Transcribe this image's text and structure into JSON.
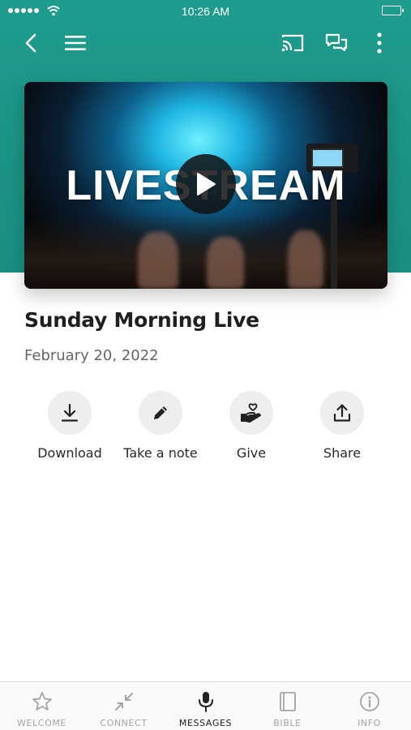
{
  "status_bar": {
    "time": "10:26 AM"
  },
  "video": {
    "overlay_text": "LIVESTREAM"
  },
  "message": {
    "title": "Sunday Morning Live",
    "date": "February 20, 2022"
  },
  "actions": [
    {
      "label": "Download",
      "icon": "download-icon"
    },
    {
      "label": "Take a note",
      "icon": "pencil-icon"
    },
    {
      "label": "Give",
      "icon": "heart-hand-icon"
    },
    {
      "label": "Share",
      "icon": "share-icon"
    }
  ],
  "tabs": [
    {
      "label": "WELCOME",
      "icon": "star-icon",
      "active": false
    },
    {
      "label": "CONNECT",
      "icon": "arrows-icon",
      "active": false
    },
    {
      "label": "MESSAGES",
      "icon": "microphone-icon",
      "active": true
    },
    {
      "label": "BIBLE",
      "icon": "book-icon",
      "active": false
    },
    {
      "label": "INFO",
      "icon": "info-icon",
      "active": false
    }
  ],
  "colors": {
    "header_teal": "#1f9c8e",
    "active_tab": "#222222",
    "inactive_tab": "#a4a4a4"
  }
}
